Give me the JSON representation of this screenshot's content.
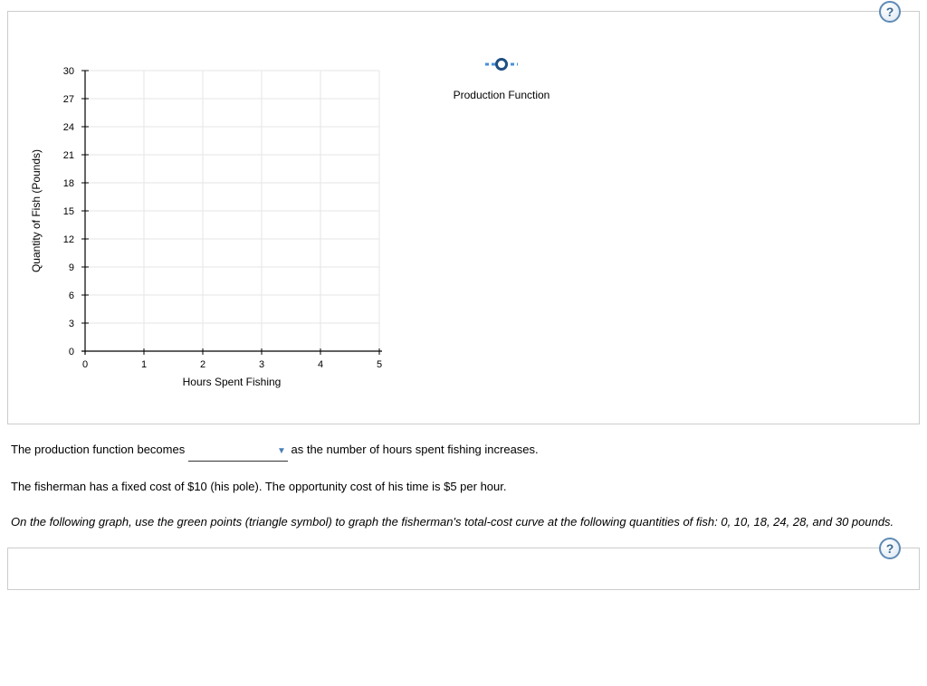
{
  "help": {
    "symbol": "?"
  },
  "chart_data": {
    "type": "scatter",
    "title": "",
    "xlabel": "Hours Spent Fishing",
    "ylabel": "Quantity of Fish (Pounds)",
    "x_ticks": [
      0,
      1,
      2,
      3,
      4,
      5
    ],
    "y_ticks": [
      0,
      3,
      6,
      9,
      12,
      15,
      18,
      21,
      24,
      27,
      30
    ],
    "xlim": [
      0,
      5
    ],
    "ylim": [
      0,
      30
    ],
    "series": [
      {
        "name": "Production Function",
        "marker": "circle",
        "color": "#4a90d9",
        "values": []
      }
    ]
  },
  "sentence1": {
    "before": "The production function becomes",
    "after": "as the number of hours spent fishing increases.",
    "blank_value": ""
  },
  "sentence2": "The fisherman has a fixed cost of $10 (his pole). The opportunity cost of his time is $5 per hour.",
  "sentence3": "On the following graph, use the green points (triangle symbol) to graph the fisherman's total-cost curve at the following quantities of fish: 0, 10, 18, 24, 28, and 30 pounds."
}
